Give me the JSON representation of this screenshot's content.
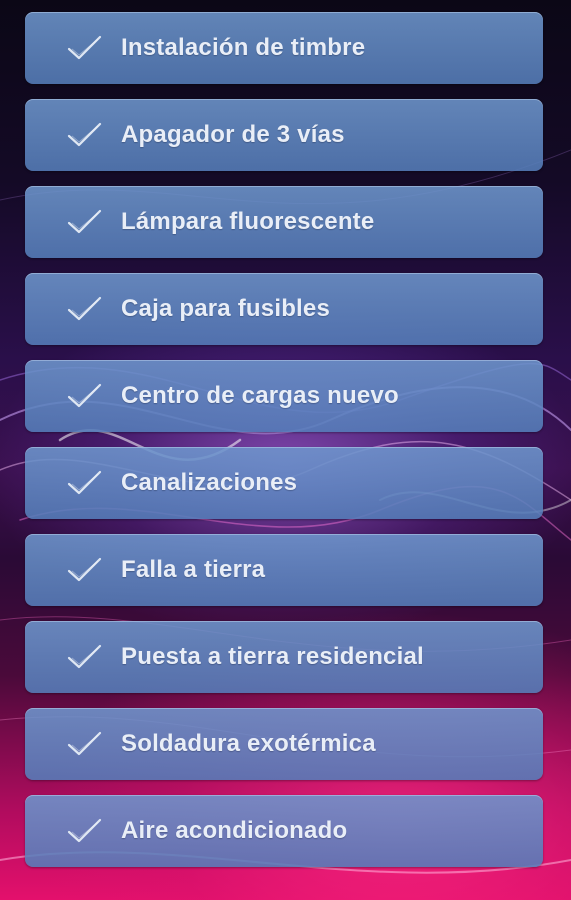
{
  "menu": {
    "items": [
      {
        "label": "Instalación de timbre",
        "icon": "check-icon"
      },
      {
        "label": "Apagador de 3 vías",
        "icon": "check-icon"
      },
      {
        "label": "Lámpara fluorescente",
        "icon": "check-icon"
      },
      {
        "label": "Caja para fusibles",
        "icon": "check-icon"
      },
      {
        "label": "Centro de cargas nuevo",
        "icon": "check-icon"
      },
      {
        "label": "Canalizaciones",
        "icon": "check-icon"
      },
      {
        "label": "Falla a tierra",
        "icon": "check-icon"
      },
      {
        "label": "Puesta a tierra residencial",
        "icon": "check-icon"
      },
      {
        "label": "Soldadura exotérmica",
        "icon": "check-icon"
      },
      {
        "label": "Aire acondicionado",
        "icon": "check-icon"
      }
    ]
  },
  "colors": {
    "button": "#6e96cd",
    "label": "#e9eef7",
    "background_top": "#0b0716",
    "background_bottom": "#e4106c"
  }
}
